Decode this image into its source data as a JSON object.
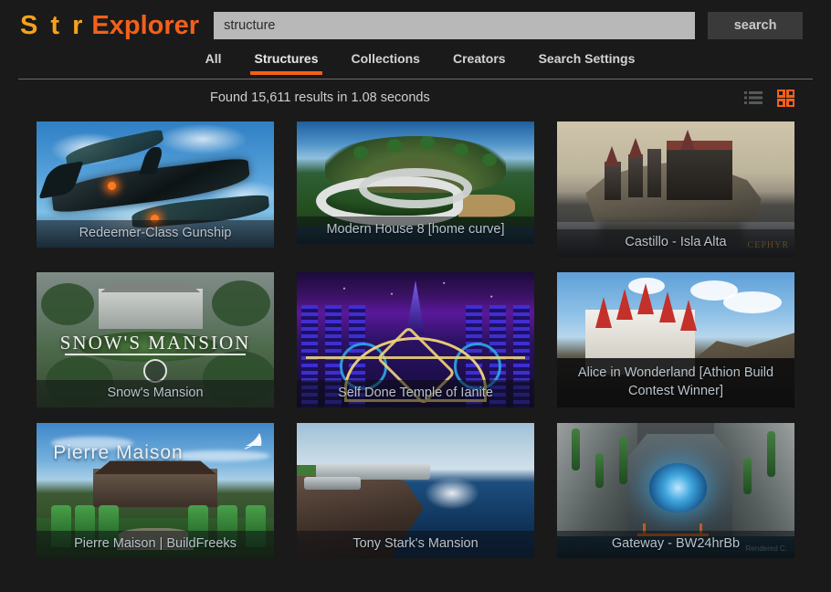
{
  "brand": {
    "logo_primary": "S t r",
    "logo_secondary": "Explorer",
    "color_primary": "#f5a21b",
    "color_secondary": "#f4601a"
  },
  "search": {
    "value": "structure",
    "placeholder": "structure",
    "button_label": "search"
  },
  "nav": {
    "items": [
      {
        "label": "All",
        "active": false
      },
      {
        "label": "Structures",
        "active": true
      },
      {
        "label": "Collections",
        "active": false
      },
      {
        "label": "Creators",
        "active": false
      },
      {
        "label": "Search Settings",
        "active": false
      }
    ]
  },
  "results": {
    "summary": "Found 15,611 results in 1.08 seconds",
    "count": "15,611",
    "seconds": "1.08",
    "view_modes": [
      {
        "name": "list-view-icon",
        "active": false,
        "color": "#55595c"
      },
      {
        "name": "grid-view-icon",
        "active": true,
        "color": "#f4601a"
      }
    ]
  },
  "grid": {
    "cards": [
      {
        "title": "Redeemer-Class Gunship",
        "art": "gunship",
        "caption_style": "light",
        "height": 138
      },
      {
        "title": "Modern House 8 [home curve]",
        "art": "modern",
        "caption_style": "light",
        "height": 134
      },
      {
        "title": "Castillo - Isla Alta",
        "art": "castillo",
        "caption_style": "light",
        "height": 148,
        "watermark": "CEPHYR"
      },
      {
        "title": "Snow's Mansion",
        "art": "snow",
        "caption_style": "light",
        "height": 148,
        "overlay_title": "SNOW'S MANSION"
      },
      {
        "title": "Self Done Temple of Ianite",
        "art": "ianite",
        "caption_style": "light",
        "height": 148
      },
      {
        "title": "Alice in Wonderland [Athion Build Contest Winner]",
        "art": "alice",
        "caption_style": "dark",
        "height": 148
      },
      {
        "title": "Pierre Maison | BuildFreeks",
        "art": "pierre",
        "caption_style": "light",
        "height": 148,
        "overlay_title": "Pierre Maison"
      },
      {
        "title": "Tony Stark's Mansion",
        "art": "stark",
        "caption_style": "light",
        "height": 148
      },
      {
        "title": "Gateway - BW24hrBb",
        "art": "gateway",
        "caption_style": "light",
        "height": 148,
        "watermark": "Rendered C."
      }
    ]
  }
}
